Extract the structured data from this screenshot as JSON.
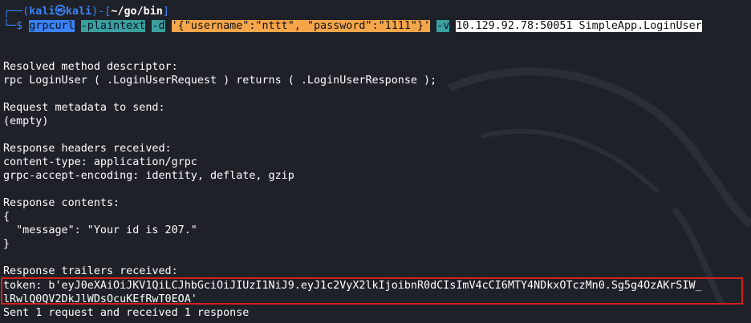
{
  "prompt": {
    "line1_prefix": "┌──(",
    "user": "kali㉿kali",
    "line1_mid": ")-[",
    "path": "~/go/bin",
    "line1_end": "]",
    "line2_prefix": "└─",
    "dollar": "$",
    "command": {
      "cmd": "grpcurl",
      "flag1": "-plaintext",
      "flag2": "-d",
      "payload": "'{\"username\":\"nttt\", \"password\":\"1111\"}'",
      "flag3": "-v",
      "target": "10.129.92.78:50051 SimpleApp.LoginUser"
    }
  },
  "output": {
    "resolved_title": "Resolved method descriptor:",
    "resolved_sig": "rpc LoginUser ( .LoginUserRequest ) returns ( .LoginUserResponse );",
    "metadata_title": "Request metadata to send:",
    "metadata_value": "(empty)",
    "headers_title": "Response headers received:",
    "header_content_type": "content-type: application/grpc",
    "header_encoding": "grpc-accept-encoding: identity, deflate, gzip",
    "contents_title": "Response contents:",
    "brace_open": "{",
    "message_line": "  \"message\": \"Your id is 207.\"",
    "brace_close": "}",
    "trailers_title": "Response trailers received:",
    "token_line1": "token: b'eyJ0eXAiOiJKV1QiLCJhbGciOiJIUzI1NiJ9.eyJ1c2VyX2lkIjoibnR0dCIsImV4cCI6MTY4NDkxOTczMn0.Sg5g4OzAKrSIW_",
    "token_line2": "lRwlQ0QV2DkJlWDsOcuKEfRwT0EOA'",
    "sent_line": "Sent 1 request and received 1 response"
  },
  "colors": {
    "background": "#1e2128",
    "prompt_blue": "#3b82f6",
    "token_box_border": "#d4201c"
  }
}
